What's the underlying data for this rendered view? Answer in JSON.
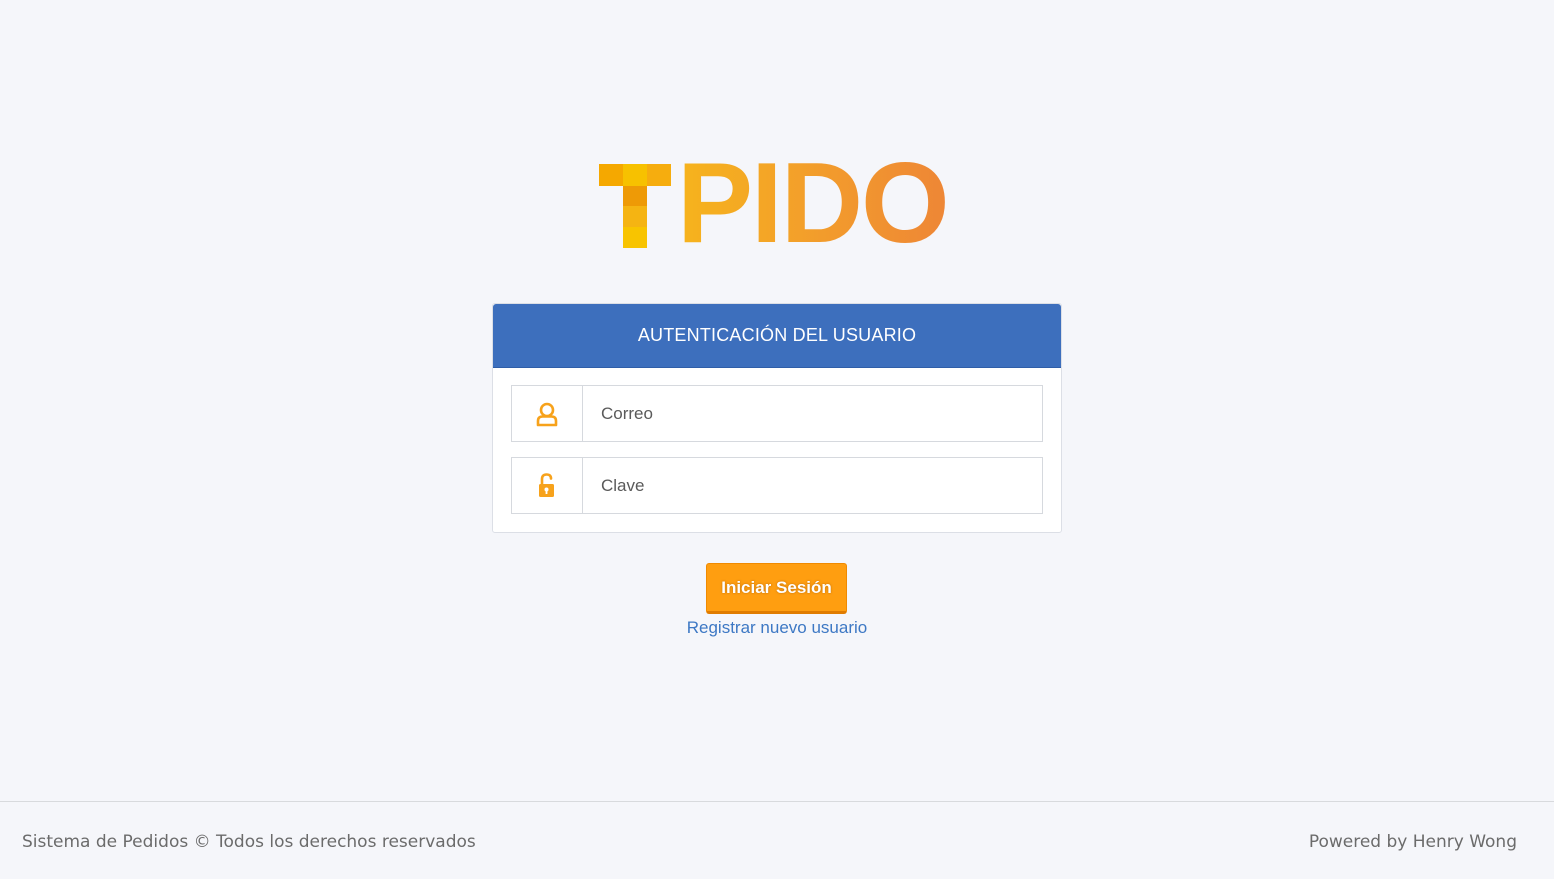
{
  "brand": {
    "logo_text": "TPIDO",
    "logo_rest": "PIDO"
  },
  "login_card": {
    "header_title": "AUTENTICACIÓN DEL USUARIO",
    "email_field": {
      "placeholder": "Correo",
      "value": "",
      "icon": "user-icon"
    },
    "password_field": {
      "placeholder": "Clave",
      "value": "",
      "icon": "unlock-icon"
    }
  },
  "actions": {
    "login_label": "Iniciar Sesión",
    "register_label": "Registrar nuevo usuario"
  },
  "footer": {
    "left_text": "Sistema de Pedidos © Todos los derechos reservados",
    "right_text": "Powered by Henry Wong"
  },
  "colors": {
    "header_blue": "#3d6fbd",
    "accent_orange": "#ff9e10",
    "link_blue": "#3d78c4",
    "icon_orange": "#f7a21b",
    "background": "#f5f6fa"
  }
}
